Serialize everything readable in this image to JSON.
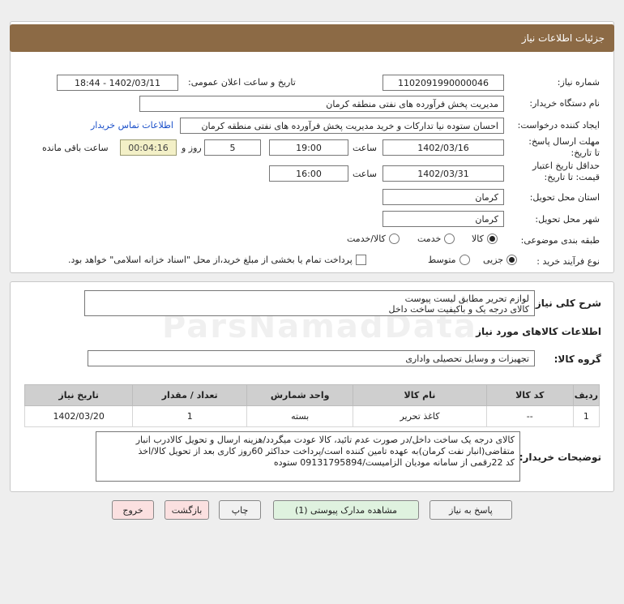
{
  "header": {
    "title": "جزئیات اطلاعات نیاز"
  },
  "form": {
    "need_number_label": "شماره نیاز:",
    "need_number": "1102091990000046",
    "announce_label": "تاریخ و ساعت اعلان عمومی:",
    "announce_value": "1402/03/11 - 18:44",
    "buyer_org_label": "نام دستگاه خریدار:",
    "buyer_org": "مدیریت پخش فرآورده های نفتی منطقه کرمان",
    "creator_label": "ایجاد کننده درخواست:",
    "creator": "احسان  ستوده نیا  تدارکات و خرید  مدیریت پخش فرآورده های نفتی منطقه کرمان",
    "contact_link": "اطلاعات تماس خریدار",
    "reply_deadline_label": "مهلت ارسال پاسخ: تا تاریخ:",
    "reply_date": "1402/03/16",
    "time_label": "ساعت",
    "reply_time": "19:00",
    "days_value": "5",
    "days_label": "روز و",
    "remaining_time": "00:04:16",
    "remaining_label": "ساعت باقی مانده",
    "price_validity_label": "حداقل تاریخ اعتبار قیمت: تا تاریخ:",
    "price_date": "1402/03/31",
    "price_time_label": "ساعت",
    "price_time": "16:00",
    "province_label": "استان محل تحویل:",
    "province": "کرمان",
    "city_label": "شهر محل تحویل:",
    "city": "کرمان",
    "category_label": "طبقه بندی موضوعی:",
    "category_options": [
      "کالا",
      "خدمت",
      "کالا/خدمت"
    ],
    "process_label": "نوع فرآیند خرید :",
    "process_options": [
      "جزیی",
      "متوسط"
    ],
    "payment_note": "پرداخت تمام یا بخشی از مبلغ خرید،از محل \"اسناد خزانه اسلامی\" خواهد بود."
  },
  "summary": {
    "label": "شرح کلی نیاز:",
    "line1": "لوازم تحریر مطابق لیست پیوست",
    "line2": "کالای درجه یک و باکیفیت ساخت داخل"
  },
  "goods": {
    "section_title": "اطلاعات کالاهای مورد نیاز",
    "group_label": "گروه کالا:",
    "group_value": "تجهیزات و وسایل تحصیلی واداری",
    "columns": [
      "ردیف",
      "کد کالا",
      "نام کالا",
      "واحد شمارش",
      "تعداد / مقدار",
      "تاریخ نیاز"
    ],
    "rows": [
      [
        "1",
        "--",
        "کاغذ تحریر",
        "بسته",
        "1",
        "1402/03/20"
      ]
    ]
  },
  "buyer_notes": {
    "label": "توضیحات خریدار:",
    "line1": "کالای درجه یک ساخت داخل/در صورت عدم تائید، کالا عودت میگردد/هزینه ارسال و تحویل کالادرب انبار",
    "line2": "متقاضی(انبار نفت کرمان)به عهده تامین کننده است/پرداخت حداکثر 60روز کاری بعد از تحویل کالا/اخذ",
    "line3": "کد 22رقمی از سامانه مودیان الزامیست/09131795894 ستوده"
  },
  "buttons": {
    "reply": "پاسخ به نیاز",
    "attachments": "مشاهده مدارک پیوستی (1)",
    "print": "چاپ",
    "back": "بازگشت",
    "exit": "خروج"
  },
  "watermark": "ParsNamadData"
}
